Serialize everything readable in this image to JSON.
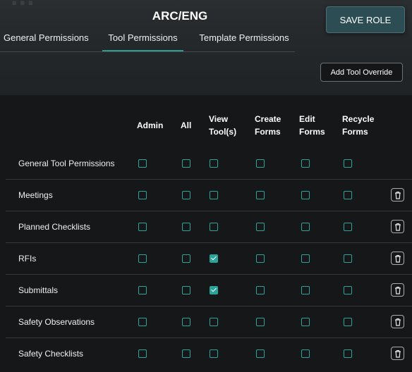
{
  "header": {
    "background_title": "...",
    "role_title": "ARC/ENG",
    "save_label": "SAVE ROLE"
  },
  "tabs": [
    {
      "label": "General Permissions",
      "active": false
    },
    {
      "label": "Tool Permissions",
      "active": true
    },
    {
      "label": "Template Permissions",
      "active": false
    }
  ],
  "add_override_label": "Add Tool Override",
  "columns": [
    "Admin",
    "All",
    "View\nTool(s)",
    "Create\nForms",
    "Edit\nForms",
    "Recycle\nForms"
  ],
  "rows": [
    {
      "label": "General Tool Permissions",
      "checks": [
        false,
        false,
        false,
        false,
        false,
        false
      ],
      "deletable": false
    },
    {
      "label": "Meetings",
      "checks": [
        false,
        false,
        false,
        false,
        false,
        false
      ],
      "deletable": true
    },
    {
      "label": "Planned Checklists",
      "checks": [
        false,
        false,
        false,
        false,
        false,
        false
      ],
      "deletable": true
    },
    {
      "label": "RFIs",
      "checks": [
        false,
        false,
        true,
        false,
        false,
        false
      ],
      "deletable": true
    },
    {
      "label": "Submittals",
      "checks": [
        false,
        false,
        true,
        false,
        false,
        false
      ],
      "deletable": true
    },
    {
      "label": "Safety Observations",
      "checks": [
        false,
        false,
        false,
        false,
        false,
        false
      ],
      "deletable": true
    },
    {
      "label": "Safety Checklists",
      "checks": [
        false,
        false,
        false,
        false,
        false,
        false
      ],
      "deletable": true
    }
  ],
  "colors": {
    "accent": "#2aa39a",
    "save_button_bg": "#2d4d55",
    "background": "#151718"
  },
  "icons": {
    "delete": "trash-icon",
    "checked": "checkmark-icon"
  }
}
